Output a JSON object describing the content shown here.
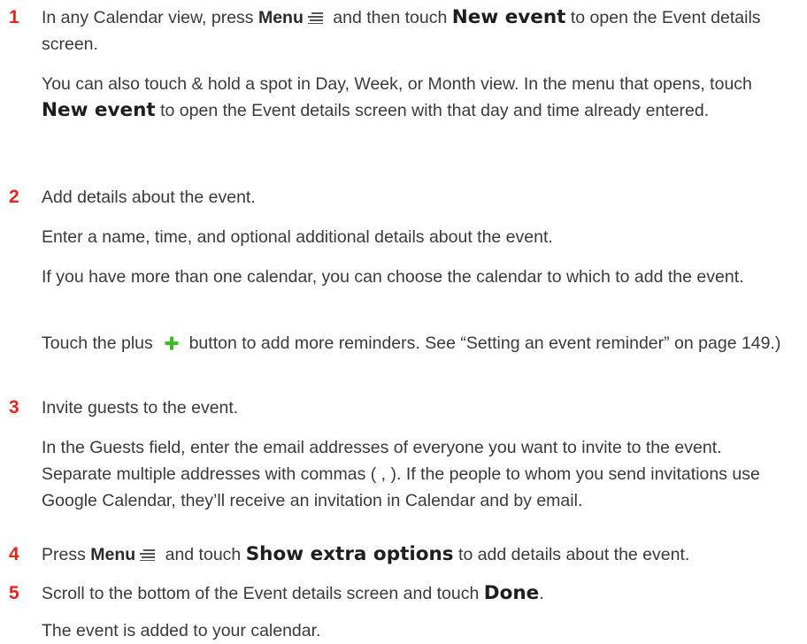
{
  "steps": [
    {
      "number": "1",
      "text_a": "In any Calendar view, press ",
      "menu": "Menu",
      "text_b": " and then touch ",
      "new_event": "New event",
      "text_c": " to open the Event details screen.",
      "note_a": "You can also touch & hold a spot in Day, Week, or Month view. In the menu that opens, touch ",
      "note_bold": "New event",
      "note_b": " to open the Event details screen with that day and time already entered."
    },
    {
      "number": "2",
      "text": "Add details about the event.",
      "p1": "Enter a name, time, and optional additional details about the event.",
      "p2": "If you have more than one calendar, you can choose the calendar to which to add the event.",
      "p3_a": "Touch the plus ",
      "p3_b": " button to add more reminders. See “Setting an event reminder” on page 149.)"
    },
    {
      "number": "3",
      "text": "Invite guests to the event.",
      "p1": "In the Guests field, enter the email addresses of everyone you want to invite to the event. Separate multiple addresses with commas ( , ). If the people to whom you send invitations use Google Calendar, they’ll receive an invitation in Calendar and by email."
    },
    {
      "number": "4",
      "text_a": "Press ",
      "menu": "Menu",
      "text_b": " and touch ",
      "option": "Show extra options",
      "text_c": " to add details about the event."
    },
    {
      "number": "5",
      "text_a": "Scroll to the bottom of the Event details screen and touch ",
      "done": "Done",
      "text_b": ".",
      "p1": "The event is added to your calendar."
    }
  ],
  "colors": {
    "step_number": "#e8231b",
    "plus_icon": "#3fb92b",
    "text": "#3a3a3a"
  },
  "icons": [
    "menu-icon",
    "plus-icon"
  ]
}
